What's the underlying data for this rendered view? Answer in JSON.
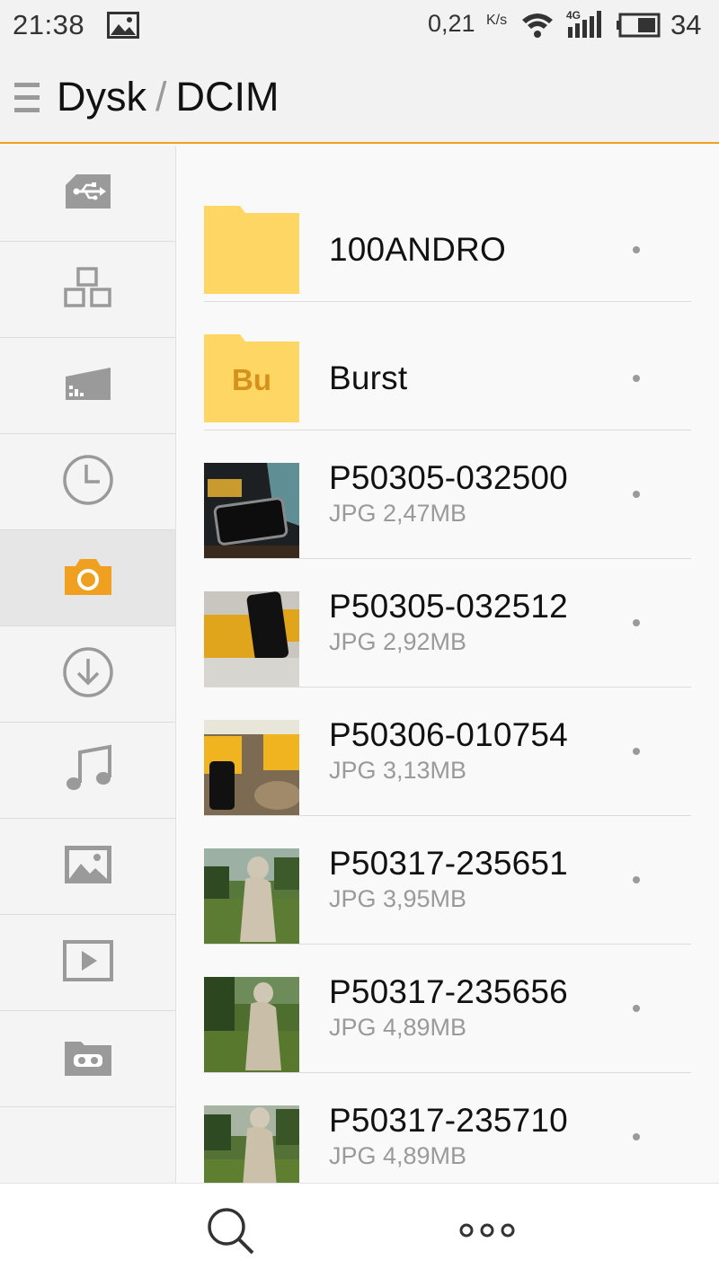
{
  "status_bar": {
    "time": "21:38",
    "speed": "0,21",
    "speed_unit": "K/s",
    "network": "4G",
    "battery": "34"
  },
  "header": {
    "root": "Dysk",
    "separator": "/",
    "folder": "DCIM"
  },
  "sidebar": {
    "items": [
      {
        "icon": "usb-icon",
        "active": false
      },
      {
        "icon": "apps-icon",
        "active": false
      },
      {
        "icon": "sd-card-icon",
        "active": false
      },
      {
        "icon": "clock-icon",
        "active": false
      },
      {
        "icon": "camera-icon",
        "active": true
      },
      {
        "icon": "download-icon",
        "active": false
      },
      {
        "icon": "music-icon",
        "active": false
      },
      {
        "icon": "image-icon",
        "active": false
      },
      {
        "icon": "video-icon",
        "active": false
      },
      {
        "icon": "vr-folder-icon",
        "active": false
      }
    ]
  },
  "files": [
    {
      "name": "100ANDRO",
      "type": "folder"
    },
    {
      "name": "Burst",
      "type": "folder",
      "badge": "Bu"
    },
    {
      "name": "P50305-032500",
      "meta": "JPG 2,47MB",
      "type": "image"
    },
    {
      "name": "P50305-032512",
      "meta": "JPG 2,92MB",
      "type": "image"
    },
    {
      "name": "P50306-010754",
      "meta": "JPG 3,13MB",
      "type": "image"
    },
    {
      "name": "P50317-235651",
      "meta": "JPG 3,95MB",
      "type": "image"
    },
    {
      "name": "P50317-235656",
      "meta": "JPG 4,89MB",
      "type": "image"
    },
    {
      "name": "P50317-235710",
      "meta": "JPG 4,89MB",
      "type": "image"
    }
  ],
  "colors": {
    "accent": "#f0a020",
    "folder": "#fdd663",
    "folder_badge": "#d6901c",
    "icon_gray": "#9a9a9a"
  }
}
